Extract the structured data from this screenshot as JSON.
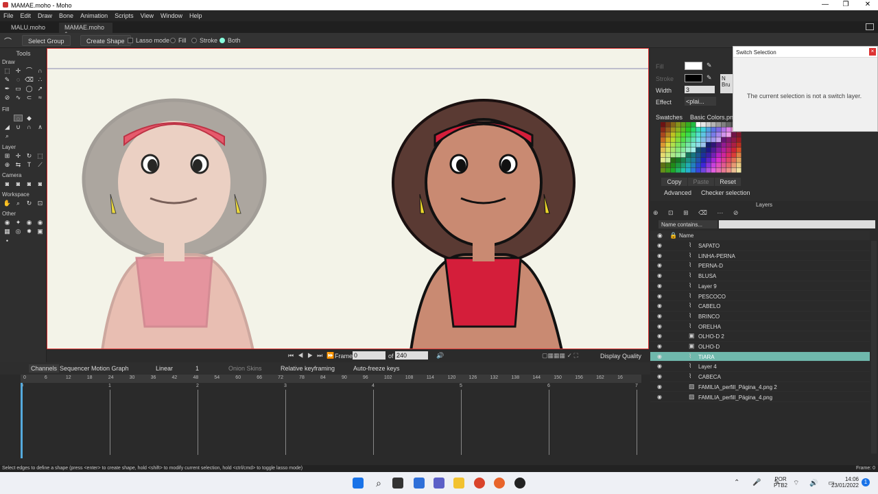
{
  "window": {
    "title": "MAMAE.moho - Moho",
    "minimize": "—",
    "maximize": "❐",
    "close": "✕"
  },
  "menu": [
    "File",
    "Edit",
    "Draw",
    "Bone",
    "Animation",
    "Scripts",
    "View",
    "Window",
    "Help"
  ],
  "doc_tabs": [
    "MALU.moho",
    "MAMAE.moho"
  ],
  "tool_options": {
    "select_group": "Select Group",
    "create_shape": "Create Shape",
    "lasso": "Lasso mode",
    "fill": "Fill",
    "stroke": "Stroke",
    "both": "Both"
  },
  "tools": {
    "header": "Tools",
    "sections": [
      "Draw",
      "Fill",
      "Layer",
      "Camera",
      "Workspace",
      "Other"
    ]
  },
  "playback": {
    "frame_label": "Frame",
    "frame_value": "0",
    "of_label": "of",
    "total": "240",
    "display_quality": "Display Quality"
  },
  "timeline": {
    "tabs": [
      "Channels",
      "Sequencer",
      "Motion Graph"
    ],
    "interp": "Linear",
    "interp_num": "1",
    "onion": "Onion Skins",
    "relkey": "Relative keyframing",
    "autofreeze": "Auto-freeze keys",
    "ticks": [
      "0",
      "6",
      "12",
      "18",
      "24",
      "30",
      "36",
      "42",
      "48",
      "54",
      "60",
      "66",
      "72",
      "78",
      "84",
      "90",
      "96",
      "102",
      "108",
      "114",
      "120",
      "126",
      "132",
      "138",
      "144",
      "150",
      "156",
      "162",
      "16"
    ],
    "sub_labels": [
      "0",
      "1",
      "2",
      "3",
      "4",
      "5",
      "6",
      "7"
    ]
  },
  "style_panel": {
    "fill": "Fill",
    "stroke": "Stroke",
    "width_label": "Width",
    "width_value": "3",
    "effect_label": "Effect",
    "effect_value": "<plai...",
    "swatches_label": "Swatches",
    "swatches_file": "Basic Colors.png",
    "copy": "Copy",
    "paste": "Paste",
    "reset": "Reset",
    "advanced": "Advanced",
    "checker": "Checker selection",
    "brush_a": "N",
    "brush_b": "Bru"
  },
  "switch_popup": {
    "title": "Switch Selection",
    "message": "The current selection is not a switch layer."
  },
  "layers_panel": {
    "title": "Layers",
    "filter": "Name contains...",
    "name_col": "Name",
    "rows": [
      {
        "name": "SAPATO",
        "icon": "vector-icon",
        "selected": false
      },
      {
        "name": "LINHA-PERNA",
        "icon": "vector-icon",
        "selected": false
      },
      {
        "name": "PERNA-D",
        "icon": "vector-icon",
        "selected": false
      },
      {
        "name": "BLUSA",
        "icon": "vector-icon",
        "selected": false
      },
      {
        "name": "Layer 9",
        "icon": "vector-icon",
        "selected": false
      },
      {
        "name": "PESCOCO",
        "icon": "vector-icon",
        "selected": false
      },
      {
        "name": "CABELO",
        "icon": "vector-icon",
        "selected": false
      },
      {
        "name": "BRINCO",
        "icon": "vector-icon",
        "selected": false
      },
      {
        "name": "ORELHA",
        "icon": "vector-icon",
        "selected": false
      },
      {
        "name": "OLHO-D 2",
        "icon": "group-icon",
        "selected": false
      },
      {
        "name": "OLHO-D",
        "icon": "group-icon",
        "selected": false
      },
      {
        "name": "TIARA",
        "icon": "vector-icon",
        "selected": true
      },
      {
        "name": "Layer 4",
        "icon": "vector-icon",
        "selected": false
      },
      {
        "name": "CABECA",
        "icon": "vector-icon",
        "selected": false
      },
      {
        "name": "FAMILIA_perfill_Página_4.png 2",
        "icon": "image-icon",
        "selected": false
      },
      {
        "name": "FAMILIA_perfill_Página_4.png",
        "icon": "image-icon",
        "selected": false
      }
    ]
  },
  "status": {
    "hint": "Select edges to define a shape (press <enter> to create shape, hold <shift> to modify current selection, hold <ctrl/cmd> to toggle lasso mode)",
    "frame": "Frame: 0"
  },
  "taskbar": {
    "lang": "POR",
    "layout": "PTB2",
    "time": "14:06",
    "date": "23/01/2022",
    "notif": "1"
  },
  "colors": {
    "selected_layer": "#6fb8ac",
    "canvas": "#f3f3e8",
    "hair": "#5a3a33",
    "top": "#d41e3a"
  }
}
